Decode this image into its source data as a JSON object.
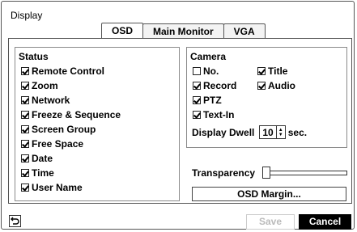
{
  "title": "Display",
  "tabs": [
    {
      "label": "OSD",
      "active": true
    },
    {
      "label": "Main Monitor",
      "active": false
    },
    {
      "label": "VGA",
      "active": false
    }
  ],
  "status": {
    "title": "Status",
    "items": [
      {
        "label": "Remote Control",
        "checked": true
      },
      {
        "label": "Zoom",
        "checked": true
      },
      {
        "label": "Network",
        "checked": true
      },
      {
        "label": "Freeze & Sequence",
        "checked": true
      },
      {
        "label": "Screen Group",
        "checked": true
      },
      {
        "label": "Free Space",
        "checked": true
      },
      {
        "label": "Date",
        "checked": true
      },
      {
        "label": "Time",
        "checked": true
      },
      {
        "label": "User Name",
        "checked": true
      }
    ]
  },
  "camera": {
    "title": "Camera",
    "no": {
      "label": "No.",
      "checked": false
    },
    "title_opt": {
      "label": "Title",
      "checked": true
    },
    "record": {
      "label": "Record",
      "checked": true
    },
    "audio": {
      "label": "Audio",
      "checked": true
    },
    "ptz": {
      "label": "PTZ",
      "checked": true
    },
    "textin": {
      "label": "Text-In",
      "checked": true
    },
    "dwell": {
      "label": "Display Dwell",
      "value": "10",
      "unit": "sec."
    }
  },
  "transparency": {
    "label": "Transparency",
    "level": 0
  },
  "osd_margin_label": "OSD Margin...",
  "buttons": {
    "save": "Save",
    "cancel": "Cancel"
  }
}
